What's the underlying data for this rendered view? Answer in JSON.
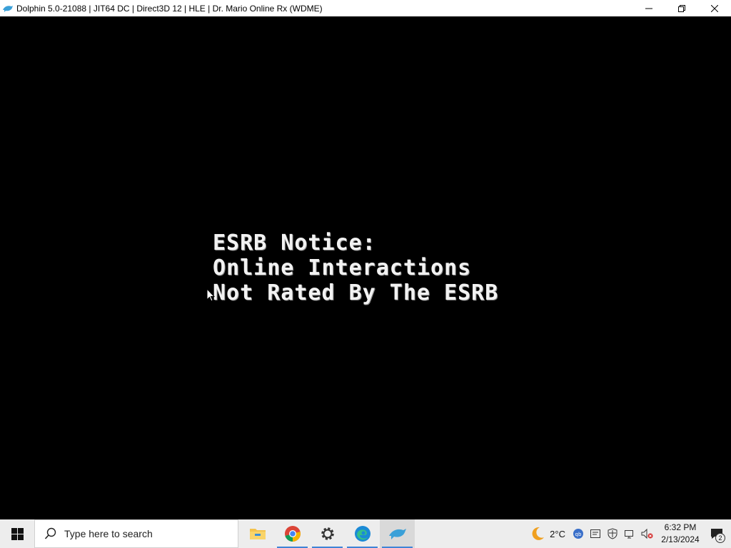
{
  "window": {
    "title": "Dolphin 5.0-21088 | JIT64 DC | Direct3D 12 | HLE | Dr. Mario Online Rx (WDME)",
    "icon": "dolphin-icon",
    "controls": [
      "minimize-icon",
      "restore-icon",
      "close-icon"
    ]
  },
  "game": {
    "lines": [
      "ESRB Notice:",
      "Online Interactions",
      "Not Rated By The ESRB"
    ]
  },
  "taskbar": {
    "search_placeholder": "Type here to search",
    "pinned": [
      {
        "name": "file-explorer",
        "running": false
      },
      {
        "name": "chrome",
        "running": true
      },
      {
        "name": "settings",
        "running": true
      },
      {
        "name": "edge",
        "running": true
      },
      {
        "name": "dolphin",
        "running": true,
        "active": true
      }
    ],
    "weather_temp": "2°C",
    "time": "6:32 PM",
    "date": "2/13/2024",
    "notification_count": "2"
  },
  "colors": {
    "taskbar_bg": "#ededed",
    "accent": "#3f84d6"
  }
}
